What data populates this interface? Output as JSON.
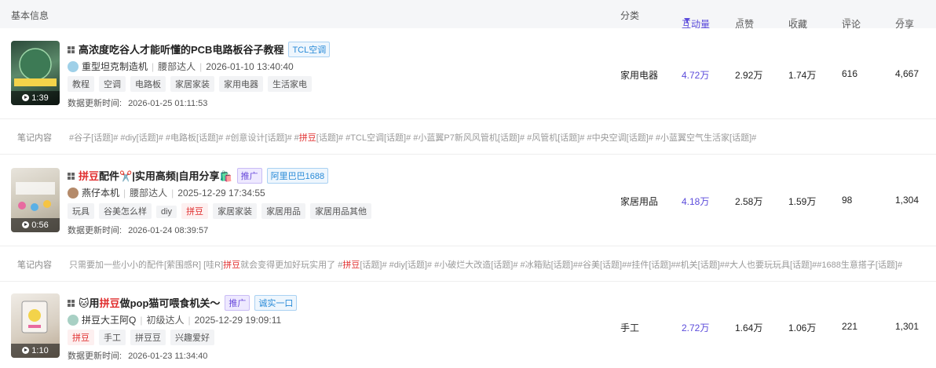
{
  "header": {
    "basic_info": "基本信息",
    "category": "分类",
    "interaction": "互动量",
    "likes": "点赞",
    "favorites": "收藏",
    "comments": "评论",
    "shares": "分享"
  },
  "note_label": "笔记内容",
  "update_label": "数据更新时间:",
  "rows": [
    {
      "thumb_duration": "1:39",
      "title_parts": [
        "高浓度吃谷人才能听懂的PCB电路板谷子教程"
      ],
      "badges": [
        "TCL空调"
      ],
      "author": "重型坦克制造机",
      "level": "腰部达人",
      "published": "2026-01-10 13:40:40",
      "tags": [
        "教程",
        "空调",
        "电路板",
        "家居家装",
        "家用电器",
        "生活家电"
      ],
      "updated": "2026-01-25 01:11:53",
      "category": "家用电器",
      "interaction": "4.72万",
      "likes": "2.92万",
      "favorites": "1.74万",
      "comments": "616",
      "shares": "4,667",
      "note_before": "#谷子[话题]# #diy[话题]# #电路板[话题]# #创意设计[话题]# #",
      "note_hl": "拼豆",
      "note_after": "[话题]# #TCL空调[话题]# #小蓝翼P7新风风管机[话题]# #风管机[话题]# #中央空调[话题]# #小蓝翼空气生活家[话题]#"
    },
    {
      "thumb_duration": "0:56",
      "title_hl": "拼豆",
      "title_rest": "配件✂️|实用高频|自用分享🛍️",
      "badges": [
        "推广",
        "阿里巴巴1688"
      ],
      "author": "燕仔本机",
      "level": "腰部达人",
      "published": "2025-12-29 17:34:55",
      "tags": [
        "玩具",
        "谷美怎么样",
        "diy",
        "拼豆",
        "家居家装",
        "家居用品",
        "家居用品其他"
      ],
      "updated": "2026-01-24 08:39:57",
      "category": "家居用品",
      "interaction": "4.18万",
      "likes": "2.58万",
      "favorites": "1.59万",
      "comments": "98",
      "shares": "1,304",
      "note_before": "只需要加一些小小的配件[萦围感R] [哇R]",
      "note_hl": "拼豆",
      "note_mid": "就会变得更加好玩实用了 #",
      "note_hl2": "拼豆",
      "note_after": "[话题]# #diy[话题]# #小破烂大改造[话题]# #冰箱贴[话题]##谷美[话题]##挂件[话题]##机关[话题]##大人也要玩玩具[话题]##1688生意搭子[话题]#"
    },
    {
      "thumb_duration": "1:10",
      "title_pre": "🐱用",
      "title_hl": "拼豆",
      "title_rest": "做pop猫可喂食机关～",
      "badges": [
        "推广",
        "诚实一口"
      ],
      "author": "拼豆大王阿Q",
      "level": "初级达人",
      "published": "2025-12-29 19:09:11",
      "tags": [
        "拼豆",
        "手工",
        "拼豆豆",
        "兴趣爱好"
      ],
      "updated": "2026-01-23 11:34:40",
      "category": "手工",
      "interaction": "2.72万",
      "likes": "1.64万",
      "favorites": "1.06万",
      "comments": "221",
      "shares": "1,301"
    }
  ],
  "colors": {
    "accent": "#5b4bdb",
    "highlight": "#e02e2e"
  }
}
